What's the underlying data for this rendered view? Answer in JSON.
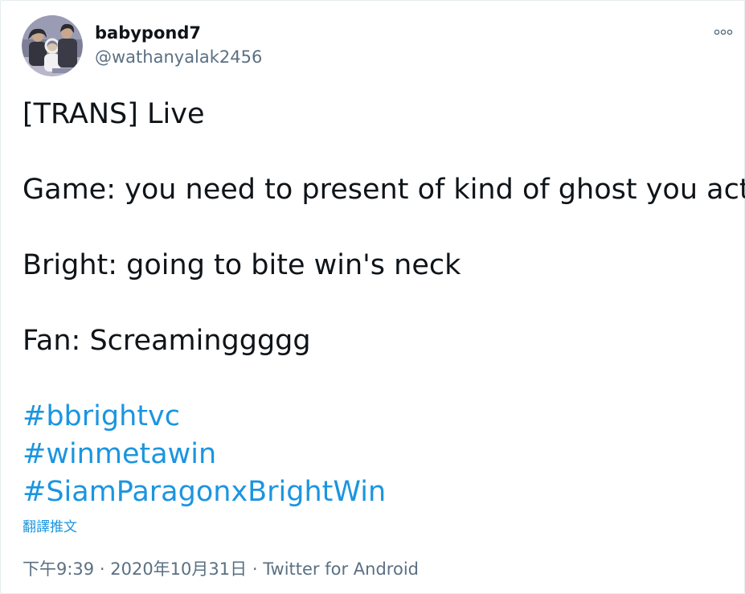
{
  "tweet": {
    "display_name": "babypond7",
    "handle": "@wathanyalak2456",
    "more_icon": "ellipsis-icon",
    "lines": {
      "l1": "[TRANS] Live",
      "l2": "Game: you need to present of kind of ghost you act",
      "l3": "Bright: going to bite win's neck",
      "l4": "Fan: Screaminggggg"
    },
    "hashtags": [
      "#bbrightvc",
      "#winmetawin",
      "#SiamParagonxBrightWin"
    ],
    "translate_label": "翻譯推文",
    "time": "下午9:39",
    "separator": "·",
    "date": "2020年10月31日",
    "source": "Twitter for Android"
  },
  "colors": {
    "link": "#1b95e0",
    "secondary_text": "#5b7083",
    "primary_text": "#0f1419",
    "border": "#e6ecf0"
  }
}
